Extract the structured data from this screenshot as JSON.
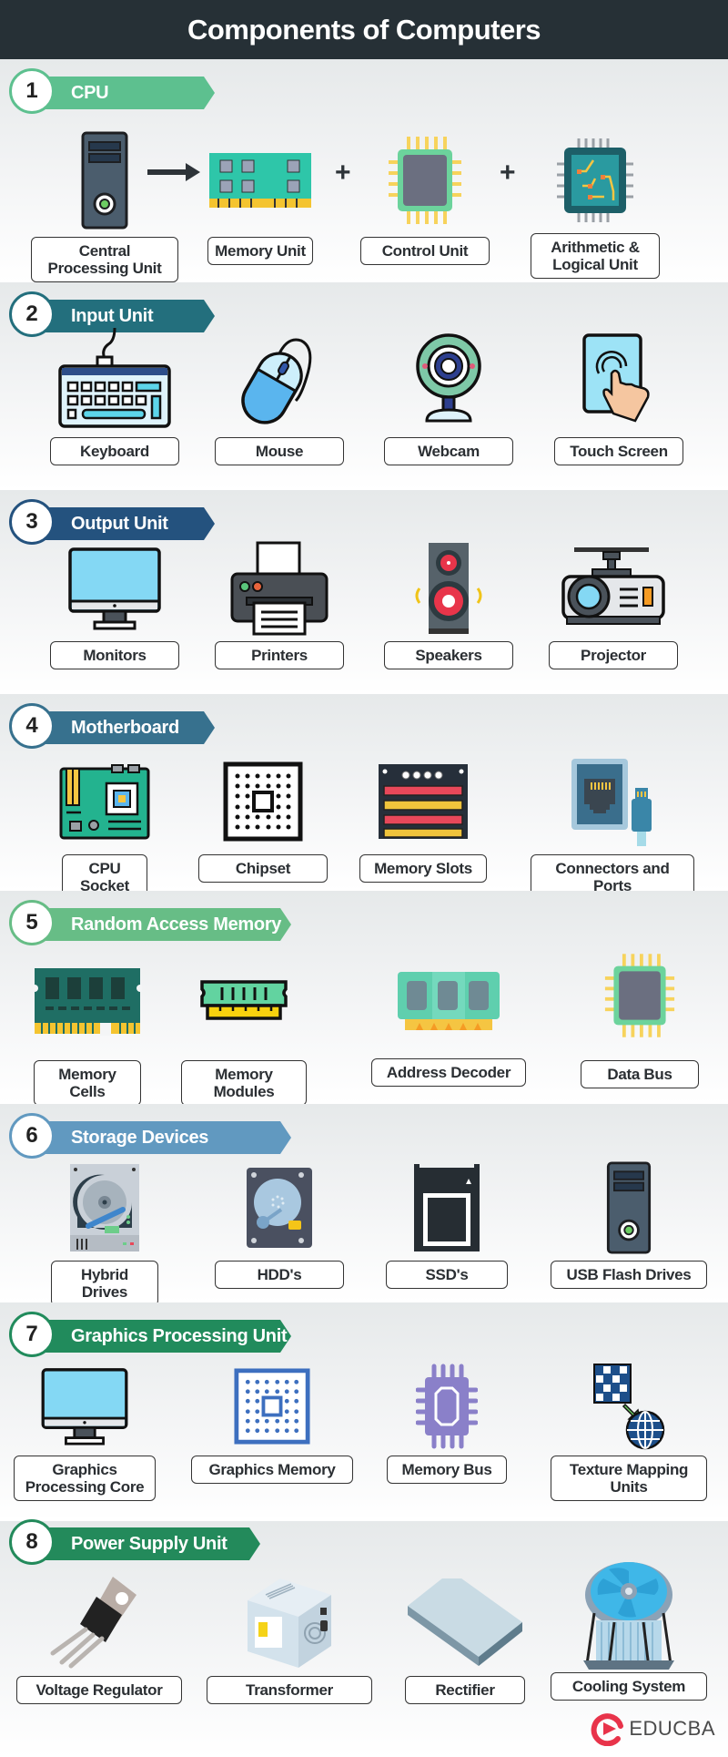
{
  "title": "Components of Computers",
  "sections": [
    {
      "num": "1",
      "title": "CPU",
      "color": "#5dc08f",
      "items": [
        {
          "label": "Central Processing Unit",
          "icon": "computer-tower-icon"
        },
        {
          "label": "Memory Unit",
          "icon": "memory-module-icon"
        },
        {
          "label": "Control Unit",
          "icon": "chip-icon"
        },
        {
          "label": "Arithmetic & Logical Unit",
          "icon": "circuit-chip-icon"
        }
      ],
      "operators": [
        "→",
        "+",
        "+"
      ]
    },
    {
      "num": "2",
      "title": "Input Unit",
      "color": "#236f7d",
      "items": [
        {
          "label": "Keyboard",
          "icon": "keyboard-icon"
        },
        {
          "label": "Mouse",
          "icon": "mouse-icon"
        },
        {
          "label": "Webcam",
          "icon": "webcam-icon"
        },
        {
          "label": "Touch Screen",
          "icon": "touch-screen-icon"
        }
      ]
    },
    {
      "num": "3",
      "title": "Output Unit",
      "color": "#24527e",
      "items": [
        {
          "label": "Monitors",
          "icon": "monitor-icon"
        },
        {
          "label": "Printers",
          "icon": "printer-icon"
        },
        {
          "label": "Speakers",
          "icon": "speaker-icon"
        },
        {
          "label": "Projector",
          "icon": "projector-icon"
        }
      ]
    },
    {
      "num": "4",
      "title": "Motherboard",
      "color": "#37718e",
      "items": [
        {
          "label": "CPU Socket",
          "icon": "motherboard-icon"
        },
        {
          "label": "Chipset",
          "icon": "chipset-icon"
        },
        {
          "label": "Memory Slots",
          "icon": "memory-slots-icon"
        },
        {
          "label": "Connectors and Ports",
          "icon": "ethernet-port-icon"
        }
      ]
    },
    {
      "num": "5",
      "title": "Random Access Memory",
      "color": "#67bd86",
      "items": [
        {
          "label": "Memory Cells",
          "icon": "ram-stick-icon"
        },
        {
          "label": "Memory Modules",
          "icon": "ram-module-icon"
        },
        {
          "label": "Address Decoder",
          "icon": "ram-decoder-icon"
        },
        {
          "label": "Data Bus",
          "icon": "chip-icon"
        }
      ]
    },
    {
      "num": "6",
      "title": "Storage Devices",
      "color": "#6199c0",
      "items": [
        {
          "label": "Hybrid Drives",
          "icon": "hybrid-drive-icon"
        },
        {
          "label": "HDD's",
          "icon": "hdd-icon"
        },
        {
          "label": "SSD's",
          "icon": "ssd-icon"
        },
        {
          "label": "USB Flash Drives",
          "icon": "computer-tower-icon"
        }
      ]
    },
    {
      "num": "7",
      "title": "Graphics Processing Unit",
      "color": "#218b5c",
      "items": [
        {
          "label": "Graphics Processing Core",
          "icon": "monitor-icon"
        },
        {
          "label": "Graphics Memory",
          "icon": "graphics-memory-icon"
        },
        {
          "label": "Memory Bus",
          "icon": "processor-icon"
        },
        {
          "label": "Texture Mapping Units",
          "icon": "texture-mapping-icon"
        }
      ]
    },
    {
      "num": "8",
      "title": "Power Supply Unit",
      "color": "#238a5b",
      "items": [
        {
          "label": "Voltage Regulator",
          "icon": "transistor-icon"
        },
        {
          "label": "Transformer",
          "icon": "power-supply-icon"
        },
        {
          "label": "Rectifier",
          "icon": "rectifier-block-icon"
        },
        {
          "label": "Cooling System",
          "icon": "cpu-cooler-icon"
        }
      ]
    }
  ],
  "brand": {
    "name": "EDUCBA",
    "color": "#e8334a"
  }
}
